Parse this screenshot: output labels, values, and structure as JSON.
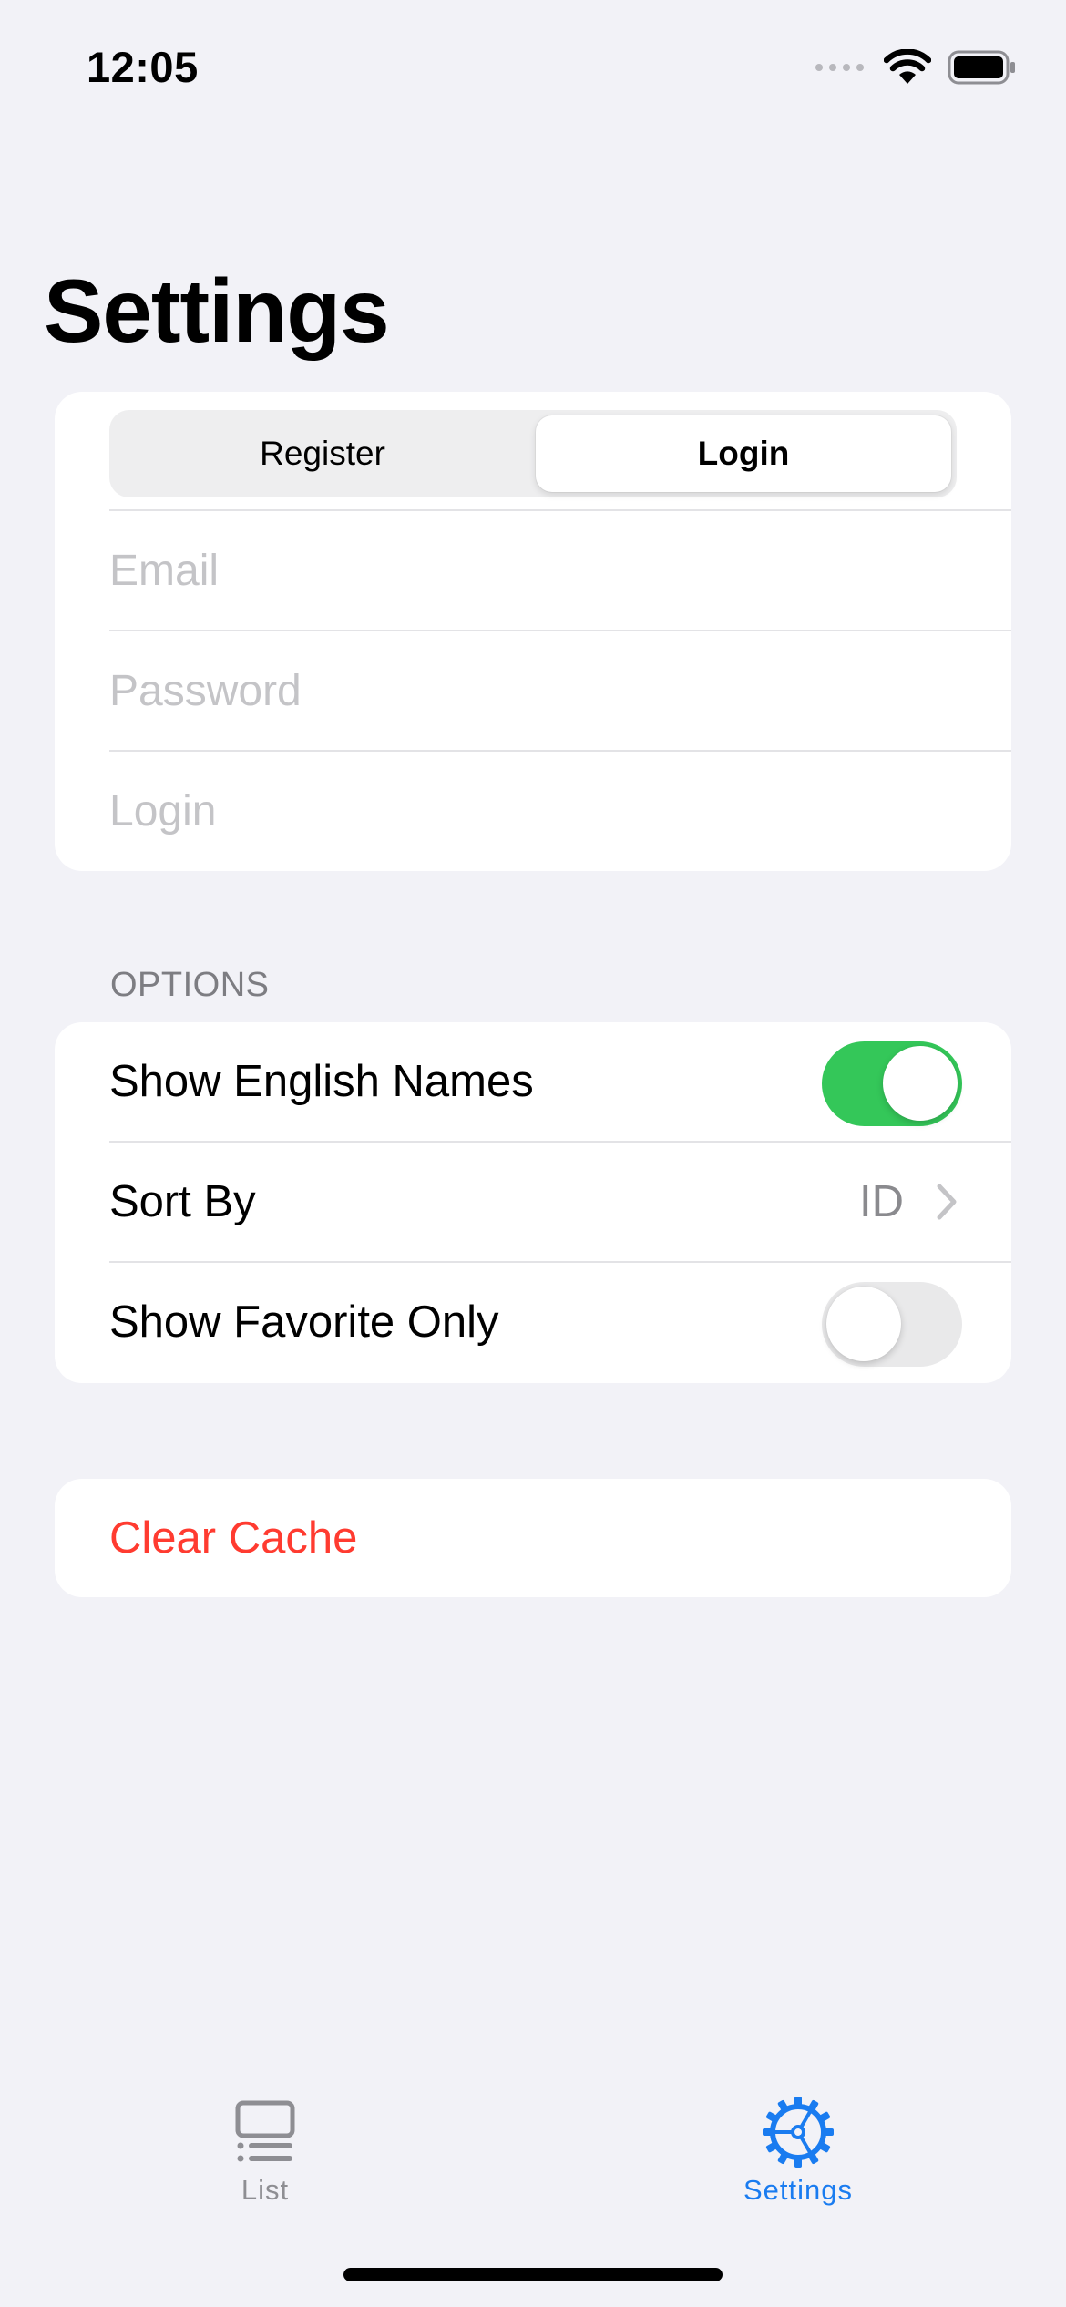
{
  "status_bar": {
    "time": "12:05"
  },
  "header": {
    "title": "Settings"
  },
  "account": {
    "segments": [
      "Register",
      "Login"
    ],
    "selected_segment": "Login",
    "email_placeholder": "Email",
    "password_placeholder": "Password",
    "login_placeholder": "Login"
  },
  "options": {
    "section_title": "OPTIONS",
    "show_english_names": {
      "label": "Show English Names",
      "on": true
    },
    "sort_by": {
      "label": "Sort By",
      "value": "ID"
    },
    "show_favorite_only": {
      "label": "Show Favorite Only",
      "on": false
    }
  },
  "actions": {
    "clear_cache_label": "Clear Cache"
  },
  "tab_bar": {
    "items": [
      {
        "label": "List",
        "icon": "list-icon",
        "selected": false
      },
      {
        "label": "Settings",
        "icon": "gear-icon",
        "selected": true
      }
    ]
  },
  "colors": {
    "accent": "#1a7cf0",
    "toggle_on": "#34c759",
    "destructive": "#ff3b30",
    "background": "#f2f2f7"
  }
}
